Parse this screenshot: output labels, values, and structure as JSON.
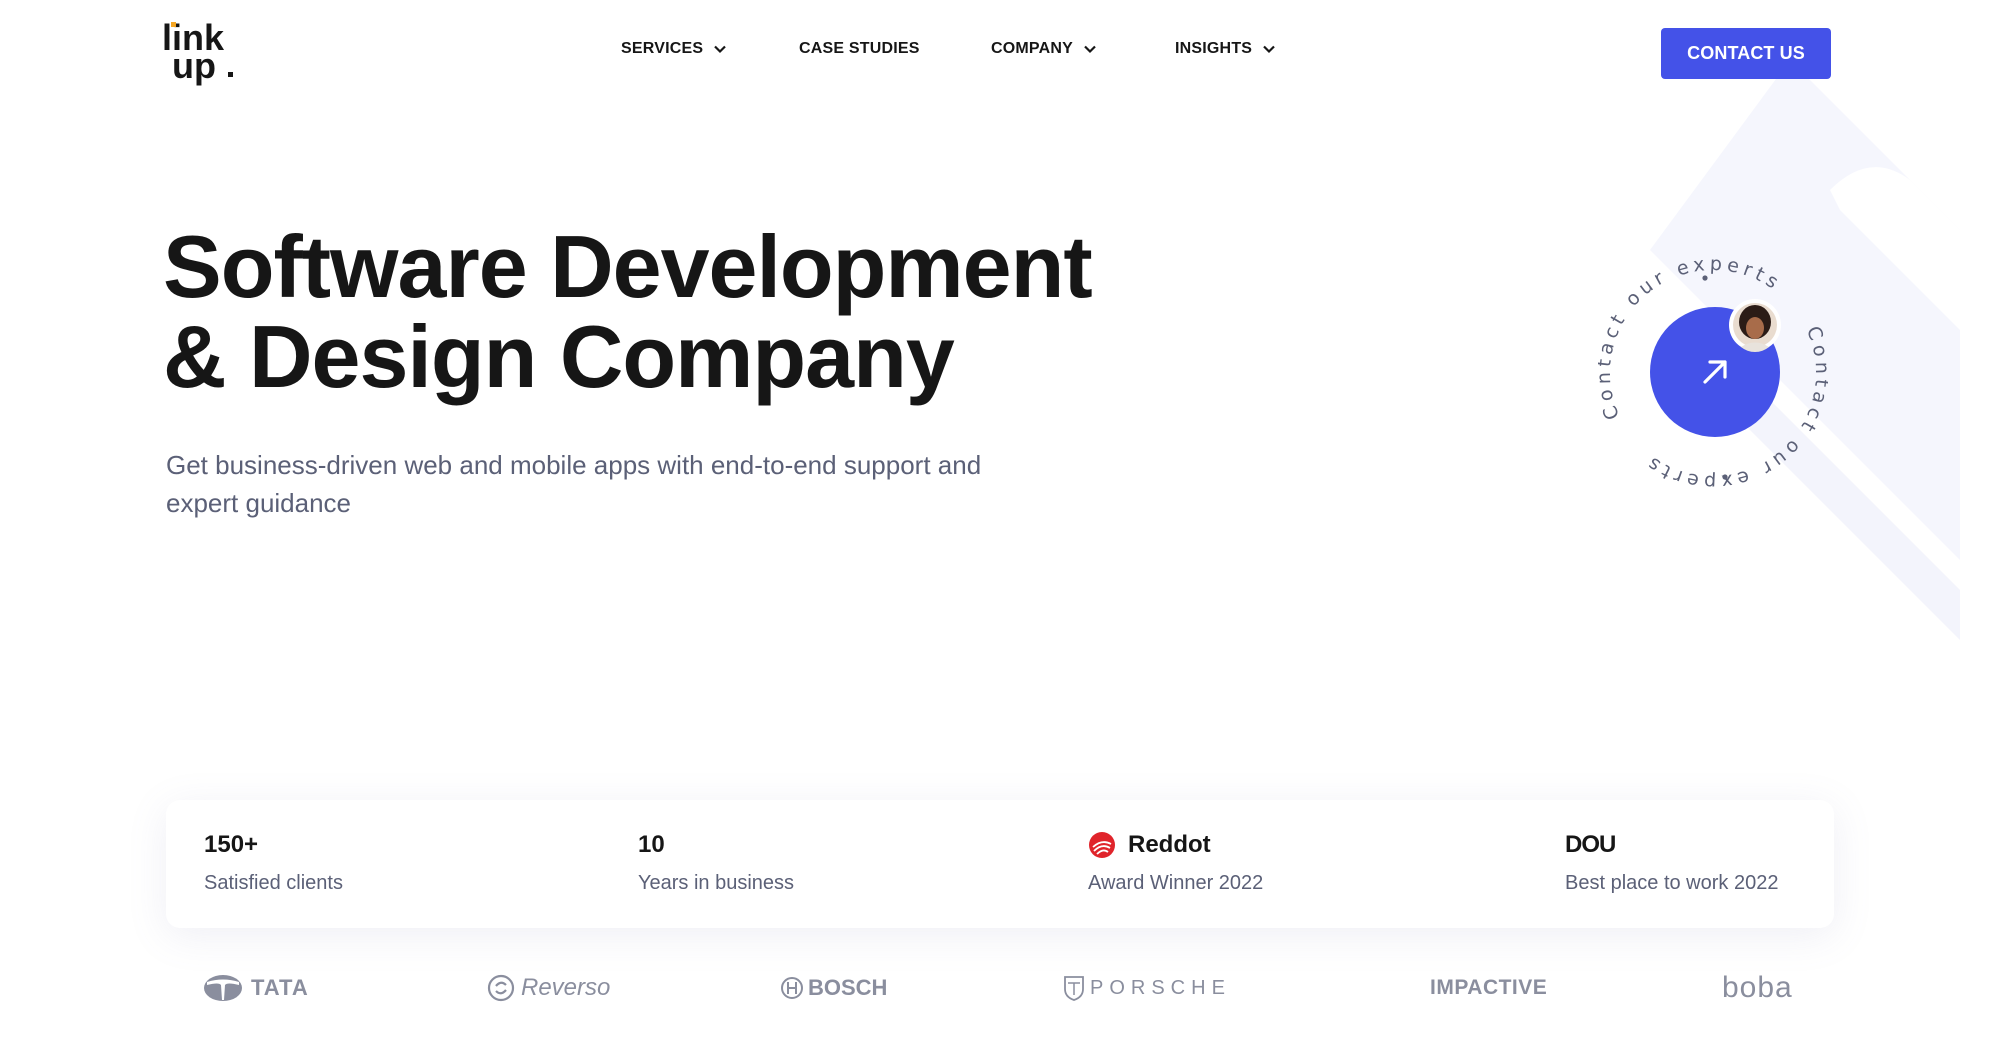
{
  "header": {
    "logo_text_line1": "link",
    "logo_text_line2": "up",
    "nav": [
      {
        "label": "SERVICES",
        "has_dropdown": true
      },
      {
        "label": "CASE STUDIES",
        "has_dropdown": false
      },
      {
        "label": "COMPANY",
        "has_dropdown": true
      },
      {
        "label": "INSIGHTS",
        "has_dropdown": true
      }
    ],
    "contact_button": "CONTACT US"
  },
  "hero": {
    "title_line1": "Software Development",
    "title_line2": "& Design Company",
    "subtitle": "Get business-driven web and mobile apps with end-to-end support and expert guidance"
  },
  "badge": {
    "ring_text": "Contact our experts",
    "icon": "arrow-up-right-icon",
    "avatar": "expert-avatar"
  },
  "stats": [
    {
      "value": "150+",
      "label": "Satisfied clients"
    },
    {
      "value": "10",
      "label": "Years in business"
    },
    {
      "value": "Reddot",
      "label": "Award Winner 2022",
      "icon": "reddot-icon"
    },
    {
      "value": "DOU",
      "label": "Best place to work 2022"
    }
  ],
  "clients": [
    "TATA",
    "Reverso",
    "BOSCH",
    "PORSCHE",
    "IMPACTIVE",
    "boba"
  ],
  "colors": {
    "accent": "#4452e8",
    "text": "#161616",
    "muted": "#5b6077",
    "logo_gray": "#8a8e9e",
    "logo_dot": "#f5a623",
    "reddot": "#e0242b",
    "deco": "#f3f4fc"
  }
}
